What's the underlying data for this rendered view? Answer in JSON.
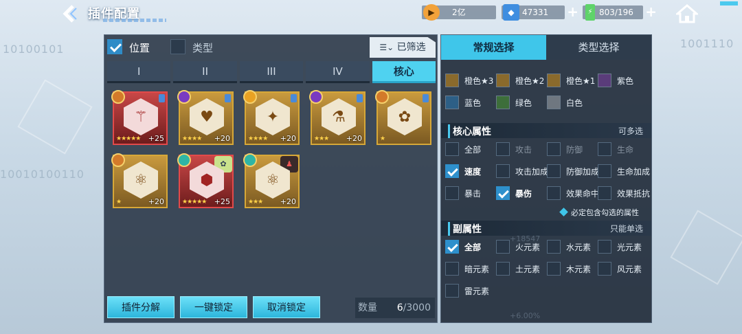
{
  "header": {
    "back_icon": "chevron-left-icon",
    "title": "插件配置",
    "resources": [
      {
        "name": "gold",
        "icon": "gold-coin-icon",
        "value": "2亿"
      },
      {
        "name": "crystal",
        "icon": "crystal-icon",
        "value": "47331"
      },
      {
        "name": "energy",
        "icon": "battery-icon",
        "value": "803/196"
      }
    ],
    "home_icon": "home-icon"
  },
  "left": {
    "position_label": "位置",
    "position_checked": true,
    "type_label": "类型",
    "type_checked": false,
    "filtered_label": "已筛选",
    "tabs": [
      "I",
      "II",
      "III",
      "IV",
      "核心"
    ],
    "active_tab": "核心",
    "plugins": [
      {
        "level": "+25",
        "stars": "★★★★★",
        "style": "red",
        "glyph": "⚚"
      },
      {
        "level": "+20",
        "stars": "★★★★",
        "style": "gold",
        "glyph": "♥"
      },
      {
        "level": "+20",
        "stars": "★★★★",
        "style": "gold",
        "glyph": "✦"
      },
      {
        "level": "+20",
        "stars": "★★★",
        "style": "gold",
        "glyph": "⚗"
      },
      {
        "level": "",
        "stars": "★",
        "style": "gold",
        "glyph": "✿"
      },
      {
        "level": "+20",
        "stars": "★",
        "style": "gold",
        "glyph": "⚛"
      },
      {
        "level": "+25",
        "stars": "★★★★★",
        "style": "red",
        "glyph": "⬢"
      },
      {
        "level": "+20",
        "stars": "★★★",
        "style": "gold",
        "glyph": "⚛"
      }
    ],
    "buttons": {
      "decompose": "插件分解",
      "lock_all": "一键锁定",
      "unlock": "取消锁定"
    },
    "count_label": "数量",
    "count_current": "6",
    "count_max": "/3000"
  },
  "right": {
    "tabs": [
      "常规选择",
      "类型选择"
    ],
    "active_tab": "常规选择",
    "colors": [
      {
        "label": "橙色★3",
        "swatch": "#8a6a2c"
      },
      {
        "label": "橙色★2",
        "swatch": "#8a6a2c"
      },
      {
        "label": "橙色★1",
        "swatch": "#8a6a2c"
      },
      {
        "label": "紫色",
        "swatch": "#5a3c7a"
      },
      {
        "label": "蓝色",
        "swatch": "#2d5f86"
      },
      {
        "label": "绿色",
        "swatch": "#3d6e3a"
      },
      {
        "label": "白色",
        "swatch": "#6f7780"
      }
    ],
    "core_section": {
      "title": "核心属性",
      "mode": "可多选"
    },
    "core_options": [
      {
        "label": "全部",
        "checked": false,
        "state": "normal"
      },
      {
        "label": "攻击",
        "checked": false,
        "state": "dim"
      },
      {
        "label": "防御",
        "checked": false,
        "state": "dim"
      },
      {
        "label": "生命",
        "checked": false,
        "state": "dim"
      },
      {
        "label": "速度",
        "checked": true,
        "state": "hi"
      },
      {
        "label": "攻击加成",
        "checked": false,
        "state": "normal"
      },
      {
        "label": "防御加成",
        "checked": false,
        "state": "normal"
      },
      {
        "label": "生命加成",
        "checked": false,
        "state": "normal"
      },
      {
        "label": "暴击",
        "checked": false,
        "state": "normal"
      },
      {
        "label": "暴伤",
        "checked": true,
        "state": "hi"
      },
      {
        "label": "效果命中",
        "checked": false,
        "state": "normal"
      },
      {
        "label": "效果抵抗",
        "checked": false,
        "state": "normal"
      }
    ],
    "must_include": "必定包含勾选的属性",
    "sub_section": {
      "title": "副属性",
      "mode": "只能单选"
    },
    "sub_options": [
      {
        "label": "全部",
        "checked": true,
        "state": "hi"
      },
      {
        "label": "火元素",
        "checked": false,
        "state": "normal"
      },
      {
        "label": "水元素",
        "checked": false,
        "state": "normal"
      },
      {
        "label": "光元素",
        "checked": false,
        "state": "normal"
      },
      {
        "label": "暗元素",
        "checked": false,
        "state": "normal"
      },
      {
        "label": "土元素",
        "checked": false,
        "state": "normal"
      },
      {
        "label": "木元素",
        "checked": false,
        "state": "normal"
      },
      {
        "label": "风元素",
        "checked": false,
        "state": "normal"
      },
      {
        "label": "雷元素",
        "checked": false,
        "state": "normal"
      }
    ]
  },
  "colors": {
    "accent": "#3fc6ea",
    "panel": "#28344a",
    "gold": "#d7a838",
    "red": "#e24a4a"
  }
}
